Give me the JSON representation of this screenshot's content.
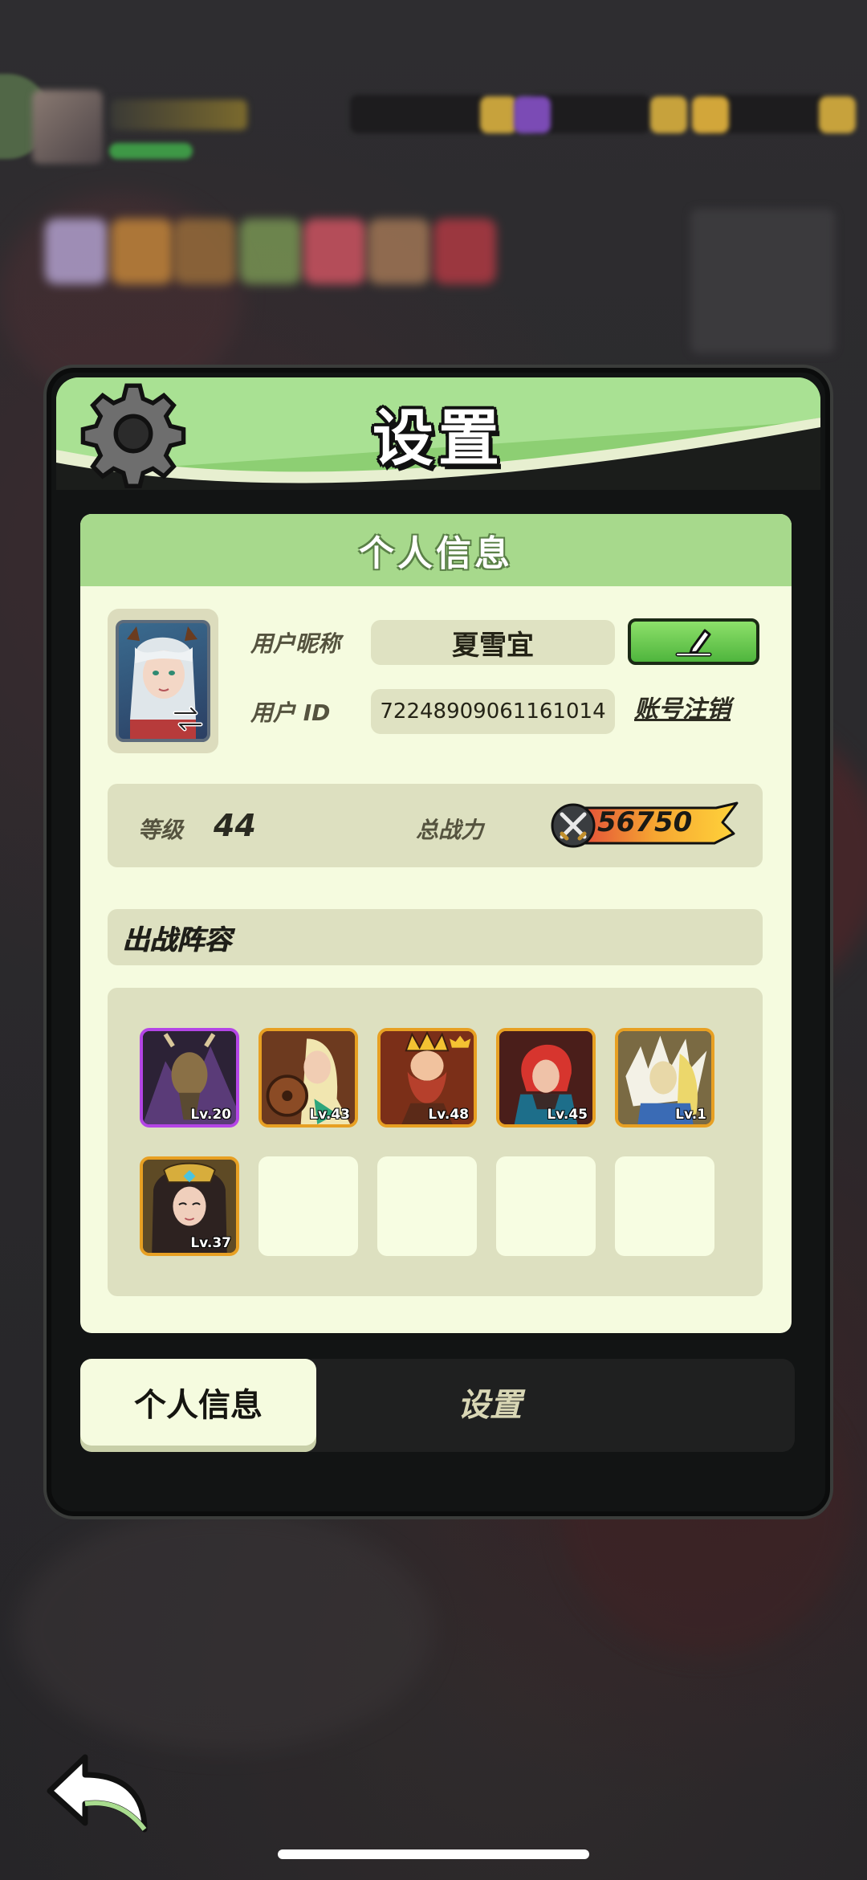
{
  "dialog": {
    "title": "设置",
    "section_title": "个人信息"
  },
  "profile": {
    "nickname_label": "用户昵称",
    "nickname": "夏雪宜",
    "id_label": "用户 ID",
    "user_id": "72248909061161014",
    "delete_account_label": "账号注销",
    "level_label": "等级",
    "level": "44",
    "power_label": "总战力",
    "power": "56750"
  },
  "lineup": {
    "title": "出战阵容",
    "heroes": [
      {
        "level": "Lv.20",
        "frame": "purple"
      },
      {
        "level": "Lv.43",
        "frame": "orange"
      },
      {
        "level": "Lv.48",
        "frame": "orange"
      },
      {
        "level": "Lv.45",
        "frame": "orange"
      },
      {
        "level": "Lv.1",
        "frame": "orange"
      },
      {
        "level": "Lv.37",
        "frame": "orange"
      }
    ],
    "empty_slots": 4
  },
  "tabs": [
    {
      "label": "个人信息",
      "active": true
    },
    {
      "label": "设置",
      "active": false
    }
  ],
  "colors": {
    "header_green": "#8dcf73",
    "panel_bg": "#f5fbdf",
    "section_head": "#a7d98c",
    "edit_button": "#4fb53d",
    "hero_frame_orange": "#e7a023",
    "hero_frame_purple": "#b445e6"
  },
  "icons": {
    "header": "gear-icon",
    "edit": "pencil-icon",
    "avatar_swap": "swap-arrows-icon",
    "power": "crossed-swords-icon",
    "back": "back-arrow-icon"
  }
}
